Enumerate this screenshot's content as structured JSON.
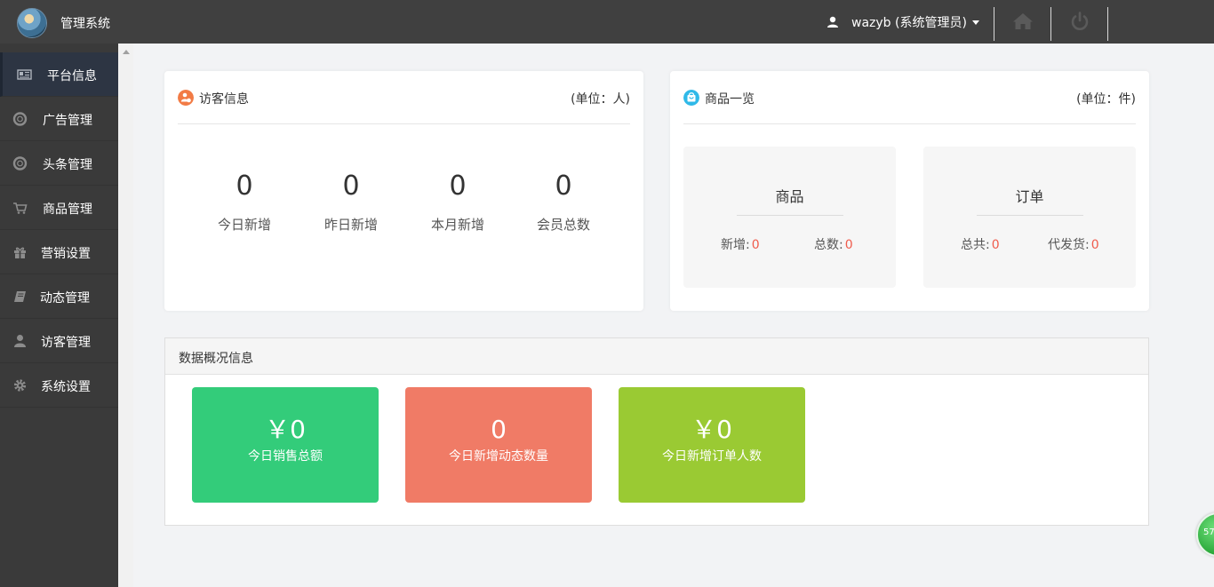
{
  "header": {
    "app_title": "管理系统",
    "user_label": "wazyb (系统管理员)",
    "icons": [
      "user-icon",
      "home-icon",
      "power-icon"
    ]
  },
  "sidebar": {
    "items": [
      {
        "label": "平台信息",
        "icon": "newspaper-icon",
        "active": true
      },
      {
        "label": "广告管理",
        "icon": "lifebuoy-icon"
      },
      {
        "label": "头条管理",
        "icon": "lifebuoy-icon"
      },
      {
        "label": "商品管理",
        "icon": "cart-icon"
      },
      {
        "label": "营销设置",
        "icon": "gift-icon"
      },
      {
        "label": "动态管理",
        "icon": "book-icon"
      },
      {
        "label": "访客管理",
        "icon": "user-icon"
      },
      {
        "label": "系统设置",
        "icon": "gear-icon"
      }
    ]
  },
  "visitor_card": {
    "title": "访客信息",
    "unit": "(单位：人)",
    "stats": [
      {
        "value": "0",
        "label": "今日新增"
      },
      {
        "value": "0",
        "label": "昨日新增"
      },
      {
        "value": "0",
        "label": "本月新增"
      },
      {
        "value": "0",
        "label": "会员总数"
      }
    ]
  },
  "goods_card": {
    "title": "商品一览",
    "unit": "(单位：件)",
    "goods": {
      "title": "商品",
      "new_label": "新增:",
      "new_value": "0",
      "total_label": "总数:",
      "total_value": "0"
    },
    "orders": {
      "title": "订单",
      "total_label": "总共:",
      "total_value": "0",
      "pending_label": "代发货:",
      "pending_value": "0"
    }
  },
  "overview": {
    "title": "数据概况信息",
    "tiles": [
      {
        "value": "￥0",
        "label": "今日销售总额",
        "color": "#33cc7a"
      },
      {
        "value": "0",
        "label": "今日新增动态数量",
        "color": "#f07b66"
      },
      {
        "value": "￥0",
        "label": "今日新增订单人数",
        "color": "#9aca33"
      }
    ]
  },
  "float_badge": "57",
  "colors": {
    "topbar": "#404040",
    "sidebar": "#3a3a3a",
    "sidebar_active": "#2d3543",
    "accent_red": "#ef5b4c",
    "visitor_icon": "#f27b45",
    "goods_icon": "#2fb9e8"
  }
}
